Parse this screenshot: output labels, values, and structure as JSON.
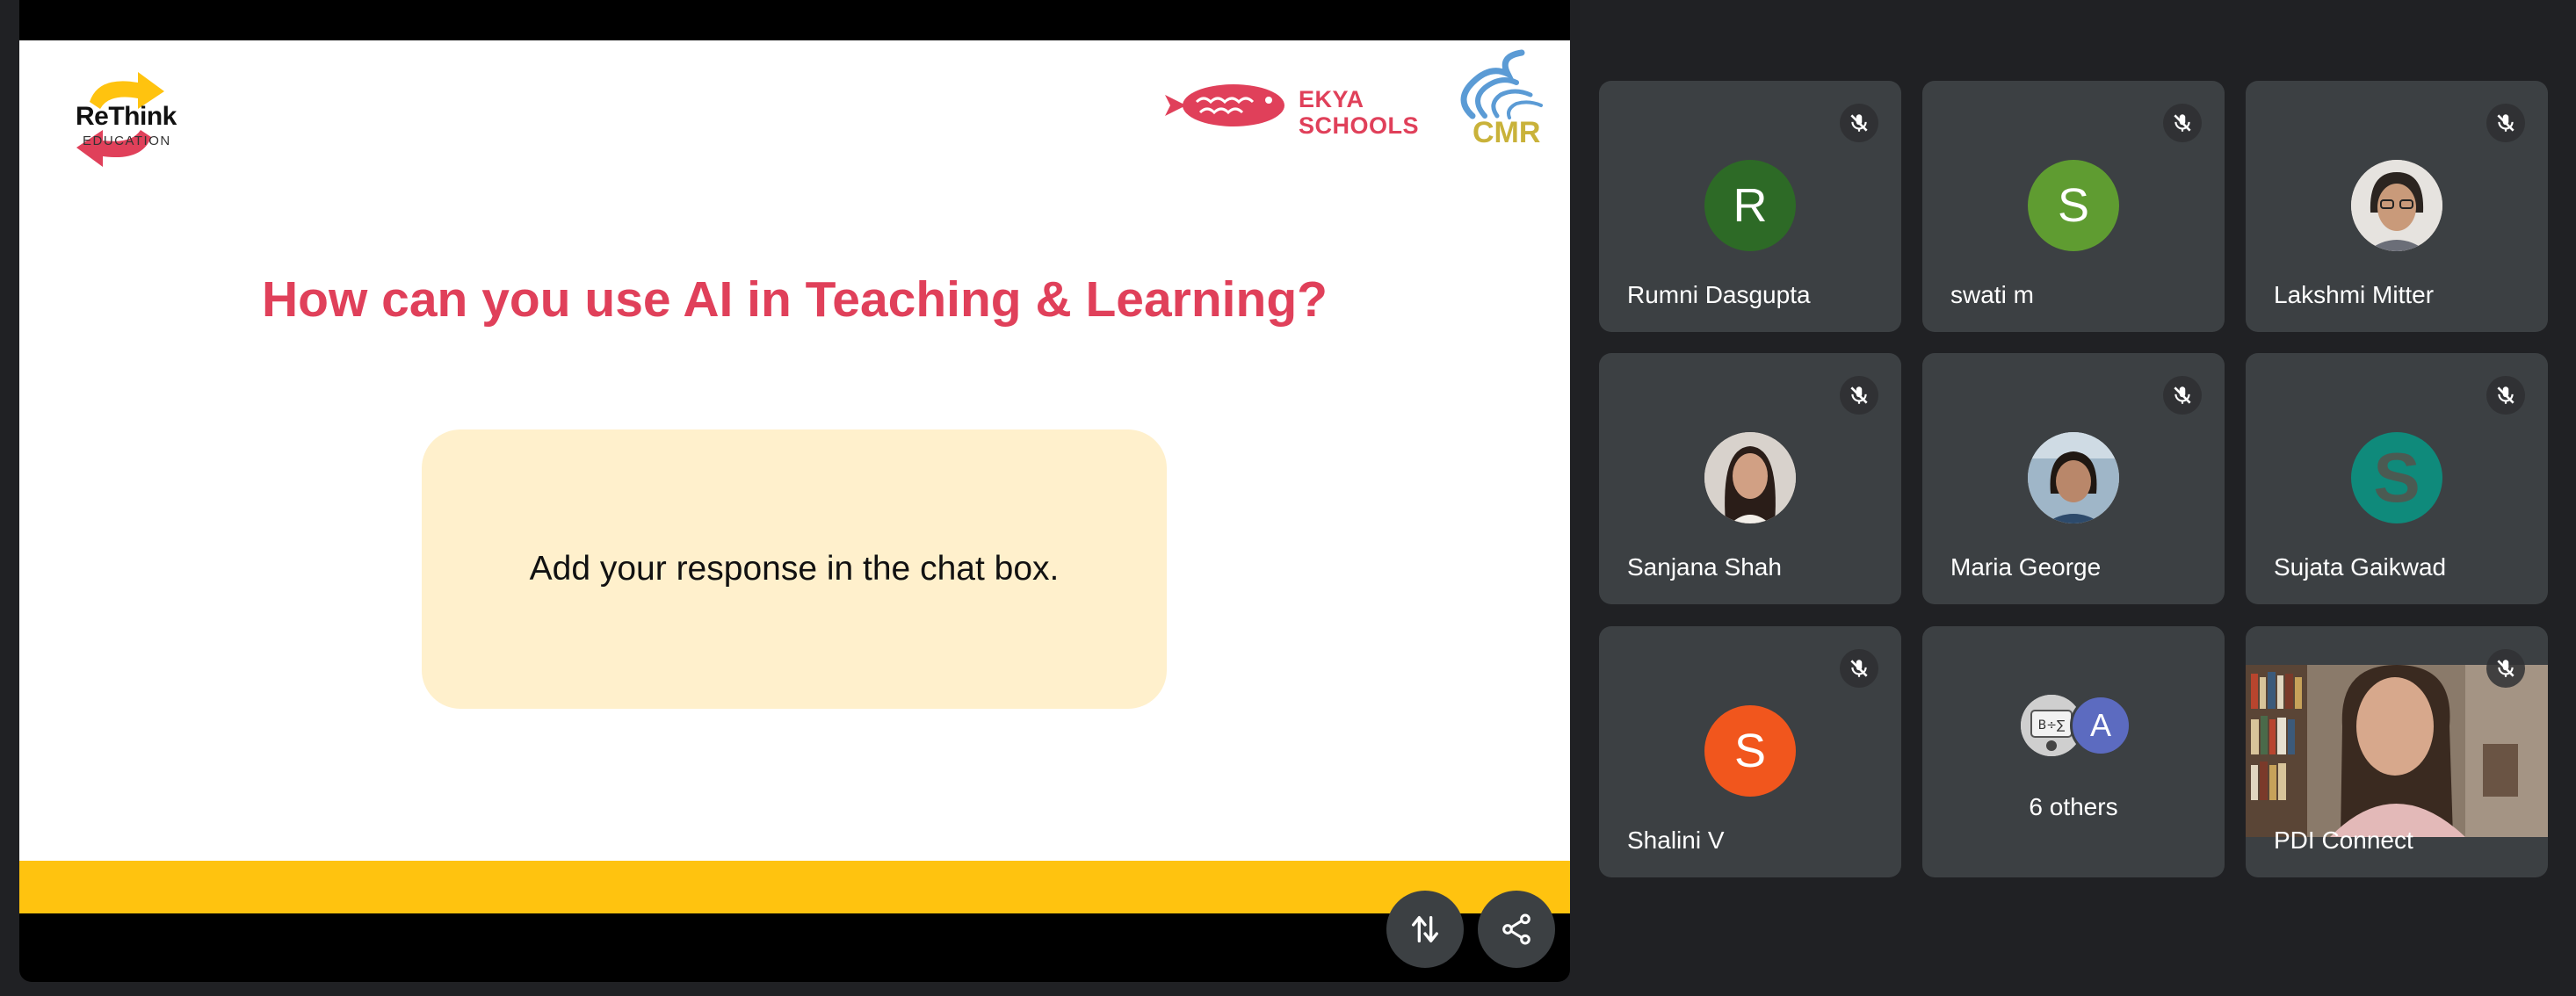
{
  "presentation": {
    "logos": {
      "rethink_main": "ReThink",
      "rethink_sub": "EDUCATION",
      "ekya_line1": "EKYA",
      "ekya_line2": "SCHOOLS",
      "cmr": "CMR"
    },
    "title": "How can you use AI in Teaching & Learning?",
    "response_prompt": "Add your response in the chat box.",
    "accent_color": "#e0405a",
    "bar_color": "#ffc30f",
    "box_color": "#fff0cc"
  },
  "controls": {
    "swap_icon": "swap-vertical-icon",
    "share_icon": "share-icon"
  },
  "participants": [
    {
      "name": "Rumni Dasgupta",
      "initial": "R",
      "color": "#2d6a26",
      "muted": true
    },
    {
      "name": "swati m",
      "initial": "S",
      "color": "#5f9c31",
      "muted": true
    },
    {
      "name": "Lakshmi Mitter",
      "initial": "",
      "photo": true,
      "muted": true
    },
    {
      "name": "Sanjana Shah",
      "initial": "",
      "photo": true,
      "muted": true
    },
    {
      "name": "Maria George",
      "initial": "",
      "photo": true,
      "muted": true
    },
    {
      "name": "Sujata Gaikwad",
      "initial": "S",
      "color": "#0f8a7b",
      "muted": true
    },
    {
      "name": "Shalini V",
      "initial": "S",
      "color": "#f1561d",
      "muted": true
    }
  ],
  "others": {
    "label": "6 others",
    "avatar_initial": "A",
    "avatar_color": "#5c6bc0"
  },
  "video_tile": {
    "name": "PDI Connect",
    "muted": true
  }
}
